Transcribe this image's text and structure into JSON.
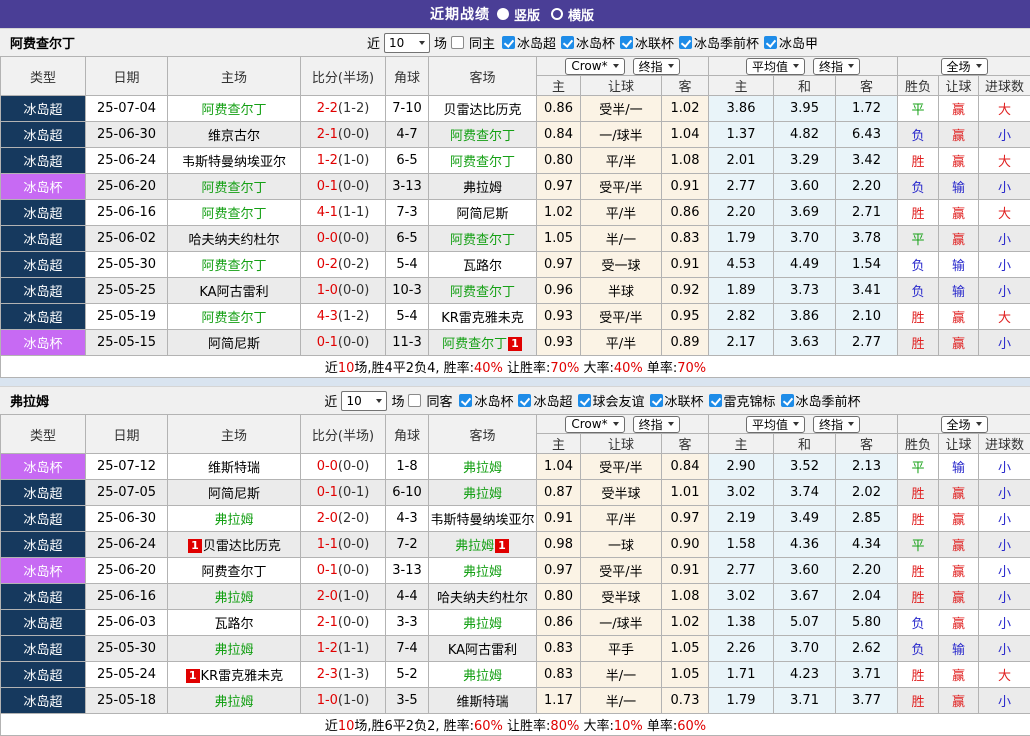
{
  "titlebar": {
    "title": "近期战绩",
    "radios": [
      {
        "id": "vertical",
        "label": "竖版",
        "checked": true
      },
      {
        "id": "horizontal",
        "label": "横版",
        "checked": false
      }
    ]
  },
  "colors": {
    "titlebar_bg": "#4a3e96",
    "league_super_bg": "#16395e",
    "league_cup_bg": "#c76af3",
    "focal_team": "#15a015",
    "score_red": "#e00000",
    "win_red": "#e02020",
    "lose_blue": "#2929cc",
    "draw_green": "#15a015",
    "crow_bg": "#fbf3e5",
    "avg_bg": "#e9f4f9",
    "stripe_bg": "#ebebeb",
    "checkbox_blue": "#1e8ce8",
    "separator_bg": "#d9e4f0"
  },
  "filter_labels": {
    "near": "近",
    "games": "场"
  },
  "badge_text": "1",
  "table_header": {
    "type": "类型",
    "date": "日期",
    "home": "主场",
    "score": "比分(半场)",
    "corner": "角球",
    "away": "客场",
    "group1": [
      "Crow*",
      "终指"
    ],
    "group2": [
      "平均值",
      "终指"
    ],
    "group3": [
      "全场"
    ],
    "sub": [
      "主",
      "让球",
      "客",
      "主",
      "和",
      "客",
      "胜负",
      "让球",
      "进球数"
    ]
  },
  "sections": [
    {
      "team": "阿费查尔丁",
      "filter": {
        "count": "10",
        "same": {
          "id": "same-home",
          "label": "同主",
          "checked": false
        },
        "leagues": [
          "冰岛超",
          "冰岛杯",
          "冰联杯",
          "冰岛季前杯",
          "冰岛甲"
        ]
      },
      "rows": [
        {
          "lg": "super",
          "type": "冰岛超",
          "date": "25-07-04",
          "home": "阿费查尔丁",
          "home_focal": true,
          "home_badge": "",
          "score": "2-2",
          "half": "(1-2)",
          "corner": "7-10",
          "away": "贝雷达比历克",
          "away_focal": false,
          "away_badge": "",
          "crow": [
            "0.86",
            "受半/一",
            "1.02"
          ],
          "avg": [
            "3.86",
            "3.95",
            "1.72"
          ],
          "res": [
            [
              "平",
              "draw"
            ],
            [
              "赢",
              "win"
            ],
            [
              "大",
              "win"
            ]
          ]
        },
        {
          "lg": "super",
          "type": "冰岛超",
          "date": "25-06-30",
          "home": "维京古尔",
          "home_focal": false,
          "home_badge": "",
          "score": "2-1",
          "half": "(0-0)",
          "corner": "4-7",
          "away": "阿费查尔丁",
          "away_focal": true,
          "away_badge": "",
          "crow": [
            "0.84",
            "一/球半",
            "1.04"
          ],
          "avg": [
            "1.37",
            "4.82",
            "6.43"
          ],
          "res": [
            [
              "负",
              "lose"
            ],
            [
              "赢",
              "win"
            ],
            [
              "小",
              "lose"
            ]
          ]
        },
        {
          "lg": "super",
          "type": "冰岛超",
          "date": "25-06-24",
          "home": "韦斯特曼纳埃亚尔",
          "home_focal": false,
          "home_badge": "",
          "score": "1-2",
          "half": "(1-0)",
          "corner": "6-5",
          "away": "阿费查尔丁",
          "away_focal": true,
          "away_badge": "",
          "crow": [
            "0.80",
            "平/半",
            "1.08"
          ],
          "avg": [
            "2.01",
            "3.29",
            "3.42"
          ],
          "res": [
            [
              "胜",
              "win"
            ],
            [
              "赢",
              "win"
            ],
            [
              "大",
              "win"
            ]
          ]
        },
        {
          "lg": "cup",
          "type": "冰岛杯",
          "date": "25-06-20",
          "home": "阿费查尔丁",
          "home_focal": true,
          "home_badge": "",
          "score": "0-1",
          "half": "(0-0)",
          "corner": "3-13",
          "away": "弗拉姆",
          "away_focal": false,
          "away_badge": "",
          "crow": [
            "0.97",
            "受平/半",
            "0.91"
          ],
          "avg": [
            "2.77",
            "3.60",
            "2.20"
          ],
          "res": [
            [
              "负",
              "lose"
            ],
            [
              "输",
              "lose"
            ],
            [
              "小",
              "lose"
            ]
          ]
        },
        {
          "lg": "super",
          "type": "冰岛超",
          "date": "25-06-16",
          "home": "阿费查尔丁",
          "home_focal": true,
          "home_badge": "",
          "score": "4-1",
          "half": "(1-1)",
          "corner": "7-3",
          "away": "阿简尼斯",
          "away_focal": false,
          "away_badge": "",
          "crow": [
            "1.02",
            "平/半",
            "0.86"
          ],
          "avg": [
            "2.20",
            "3.69",
            "2.71"
          ],
          "res": [
            [
              "胜",
              "win"
            ],
            [
              "赢",
              "win"
            ],
            [
              "大",
              "win"
            ]
          ]
        },
        {
          "lg": "super",
          "type": "冰岛超",
          "date": "25-06-02",
          "home": "哈夫纳夫约杜尔",
          "home_focal": false,
          "home_badge": "",
          "score": "0-0",
          "half": "(0-0)",
          "corner": "6-5",
          "away": "阿费查尔丁",
          "away_focal": true,
          "away_badge": "",
          "crow": [
            "1.05",
            "半/一",
            "0.83"
          ],
          "avg": [
            "1.79",
            "3.70",
            "3.78"
          ],
          "res": [
            [
              "平",
              "draw"
            ],
            [
              "赢",
              "win"
            ],
            [
              "小",
              "lose"
            ]
          ]
        },
        {
          "lg": "super",
          "type": "冰岛超",
          "date": "25-05-30",
          "home": "阿费查尔丁",
          "home_focal": true,
          "home_badge": "",
          "score": "0-2",
          "half": "(0-2)",
          "corner": "5-4",
          "away": "瓦路尔",
          "away_focal": false,
          "away_badge": "",
          "crow": [
            "0.97",
            "受一球",
            "0.91"
          ],
          "avg": [
            "4.53",
            "4.49",
            "1.54"
          ],
          "res": [
            [
              "负",
              "lose"
            ],
            [
              "输",
              "lose"
            ],
            [
              "小",
              "lose"
            ]
          ]
        },
        {
          "lg": "super",
          "type": "冰岛超",
          "date": "25-05-25",
          "home": "KA阿古雷利",
          "home_focal": false,
          "home_badge": "",
          "score": "1-0",
          "half": "(0-0)",
          "corner": "10-3",
          "away": "阿费查尔丁",
          "away_focal": true,
          "away_badge": "",
          "crow": [
            "0.96",
            "半球",
            "0.92"
          ],
          "avg": [
            "1.89",
            "3.73",
            "3.41"
          ],
          "res": [
            [
              "负",
              "lose"
            ],
            [
              "输",
              "lose"
            ],
            [
              "小",
              "lose"
            ]
          ]
        },
        {
          "lg": "super",
          "type": "冰岛超",
          "date": "25-05-19",
          "home": "阿费查尔丁",
          "home_focal": true,
          "home_badge": "",
          "score": "4-3",
          "half": "(1-2)",
          "corner": "5-4",
          "away": "KR雷克雅未克",
          "away_focal": false,
          "away_badge": "",
          "crow": [
            "0.93",
            "受平/半",
            "0.95"
          ],
          "avg": [
            "2.82",
            "3.86",
            "2.10"
          ],
          "res": [
            [
              "胜",
              "win"
            ],
            [
              "赢",
              "win"
            ],
            [
              "大",
              "win"
            ]
          ]
        },
        {
          "lg": "cup",
          "type": "冰岛杯",
          "date": "25-05-15",
          "home": "阿简尼斯",
          "home_focal": false,
          "home_badge": "",
          "score": "0-1",
          "half": "(0-0)",
          "corner": "11-3",
          "away": "阿费查尔丁",
          "away_focal": true,
          "away_badge": "after",
          "crow": [
            "0.93",
            "平/半",
            "0.89"
          ],
          "avg": [
            "2.17",
            "3.63",
            "2.77"
          ],
          "res": [
            [
              "胜",
              "win"
            ],
            [
              "赢",
              "win"
            ],
            [
              "小",
              "lose"
            ]
          ]
        }
      ],
      "summary": [
        {
          "text": "近",
          "red": false
        },
        {
          "text": "10",
          "red": true
        },
        {
          "text": "场,胜4平2负4, 胜率:",
          "red": false
        },
        {
          "text": "40%",
          "red": true
        },
        {
          "text": " 让胜率:",
          "red": false
        },
        {
          "text": "70%",
          "red": true
        },
        {
          "text": " 大率:",
          "red": false
        },
        {
          "text": "40%",
          "red": true
        },
        {
          "text": " 单率:",
          "red": false
        },
        {
          "text": "70%",
          "red": true
        }
      ]
    },
    {
      "team": "弗拉姆",
      "filter": {
        "count": "10",
        "same": {
          "id": "same-away",
          "label": "同客",
          "checked": false
        },
        "leagues": [
          "冰岛杯",
          "冰岛超",
          "球会友谊",
          "冰联杯",
          "雷克锦标",
          "冰岛季前杯"
        ]
      },
      "rows": [
        {
          "lg": "cup",
          "type": "冰岛杯",
          "date": "25-07-12",
          "home": "维斯特瑞",
          "home_focal": false,
          "home_badge": "",
          "score": "0-0",
          "half": "(0-0)",
          "corner": "1-8",
          "away": "弗拉姆",
          "away_focal": true,
          "away_badge": "",
          "crow": [
            "1.04",
            "受平/半",
            "0.84"
          ],
          "avg": [
            "2.90",
            "3.52",
            "2.13"
          ],
          "res": [
            [
              "平",
              "draw"
            ],
            [
              "输",
              "lose"
            ],
            [
              "小",
              "lose"
            ]
          ]
        },
        {
          "lg": "super",
          "type": "冰岛超",
          "date": "25-07-05",
          "home": "阿简尼斯",
          "home_focal": false,
          "home_badge": "",
          "score": "0-1",
          "half": "(0-1)",
          "corner": "6-10",
          "away": "弗拉姆",
          "away_focal": true,
          "away_badge": "",
          "crow": [
            "0.87",
            "受半球",
            "1.01"
          ],
          "avg": [
            "3.02",
            "3.74",
            "2.02"
          ],
          "res": [
            [
              "胜",
              "win"
            ],
            [
              "赢",
              "win"
            ],
            [
              "小",
              "lose"
            ]
          ]
        },
        {
          "lg": "super",
          "type": "冰岛超",
          "date": "25-06-30",
          "home": "弗拉姆",
          "home_focal": true,
          "home_badge": "",
          "score": "2-0",
          "half": "(2-0)",
          "corner": "4-3",
          "away": "韦斯特曼纳埃亚尔",
          "away_focal": false,
          "away_badge": "",
          "crow": [
            "0.91",
            "平/半",
            "0.97"
          ],
          "avg": [
            "2.19",
            "3.49",
            "2.85"
          ],
          "res": [
            [
              "胜",
              "win"
            ],
            [
              "赢",
              "win"
            ],
            [
              "小",
              "lose"
            ]
          ]
        },
        {
          "lg": "super",
          "type": "冰岛超",
          "date": "25-06-24",
          "home": "贝雷达比历克",
          "home_focal": false,
          "home_badge": "before",
          "score": "1-1",
          "half": "(0-0)",
          "corner": "7-2",
          "away": "弗拉姆",
          "away_focal": true,
          "away_badge": "after",
          "crow": [
            "0.98",
            "一球",
            "0.90"
          ],
          "avg": [
            "1.58",
            "4.36",
            "4.34"
          ],
          "res": [
            [
              "平",
              "draw"
            ],
            [
              "赢",
              "win"
            ],
            [
              "小",
              "lose"
            ]
          ]
        },
        {
          "lg": "cup",
          "type": "冰岛杯",
          "date": "25-06-20",
          "home": "阿费查尔丁",
          "home_focal": false,
          "home_badge": "",
          "score": "0-1",
          "half": "(0-0)",
          "corner": "3-13",
          "away": "弗拉姆",
          "away_focal": true,
          "away_badge": "",
          "crow": [
            "0.97",
            "受平/半",
            "0.91"
          ],
          "avg": [
            "2.77",
            "3.60",
            "2.20"
          ],
          "res": [
            [
              "胜",
              "win"
            ],
            [
              "赢",
              "win"
            ],
            [
              "小",
              "lose"
            ]
          ]
        },
        {
          "lg": "super",
          "type": "冰岛超",
          "date": "25-06-16",
          "home": "弗拉姆",
          "home_focal": true,
          "home_badge": "",
          "score": "2-0",
          "half": "(1-0)",
          "corner": "4-4",
          "away": "哈夫纳夫约杜尔",
          "away_focal": false,
          "away_badge": "",
          "crow": [
            "0.80",
            "受半球",
            "1.08"
          ],
          "avg": [
            "3.02",
            "3.67",
            "2.04"
          ],
          "res": [
            [
              "胜",
              "win"
            ],
            [
              "赢",
              "win"
            ],
            [
              "小",
              "lose"
            ]
          ]
        },
        {
          "lg": "super",
          "type": "冰岛超",
          "date": "25-06-03",
          "home": "瓦路尔",
          "home_focal": false,
          "home_badge": "",
          "score": "2-1",
          "half": "(0-0)",
          "corner": "3-3",
          "away": "弗拉姆",
          "away_focal": true,
          "away_badge": "",
          "crow": [
            "0.86",
            "一/球半",
            "1.02"
          ],
          "avg": [
            "1.38",
            "5.07",
            "5.80"
          ],
          "res": [
            [
              "负",
              "lose"
            ],
            [
              "赢",
              "win"
            ],
            [
              "小",
              "lose"
            ]
          ]
        },
        {
          "lg": "super",
          "type": "冰岛超",
          "date": "25-05-30",
          "home": "弗拉姆",
          "home_focal": true,
          "home_badge": "",
          "score": "1-2",
          "half": "(1-1)",
          "corner": "7-4",
          "away": "KA阿古雷利",
          "away_focal": false,
          "away_badge": "",
          "crow": [
            "0.83",
            "平手",
            "1.05"
          ],
          "avg": [
            "2.26",
            "3.70",
            "2.62"
          ],
          "res": [
            [
              "负",
              "lose"
            ],
            [
              "输",
              "lose"
            ],
            [
              "小",
              "lose"
            ]
          ]
        },
        {
          "lg": "super",
          "type": "冰岛超",
          "date": "25-05-24",
          "home": "KR雷克雅未克",
          "home_focal": false,
          "home_badge": "before",
          "score": "2-3",
          "half": "(1-3)",
          "corner": "5-2",
          "away": "弗拉姆",
          "away_focal": true,
          "away_badge": "",
          "crow": [
            "0.83",
            "半/一",
            "1.05"
          ],
          "avg": [
            "1.71",
            "4.23",
            "3.71"
          ],
          "res": [
            [
              "胜",
              "win"
            ],
            [
              "赢",
              "win"
            ],
            [
              "大",
              "win"
            ]
          ]
        },
        {
          "lg": "super",
          "type": "冰岛超",
          "date": "25-05-18",
          "home": "弗拉姆",
          "home_focal": true,
          "home_badge": "",
          "score": "1-0",
          "half": "(1-0)",
          "corner": "3-5",
          "away": "维斯特瑞",
          "away_focal": false,
          "away_badge": "",
          "crow": [
            "1.17",
            "半/一",
            "0.73"
          ],
          "avg": [
            "1.79",
            "3.71",
            "3.77"
          ],
          "res": [
            [
              "胜",
              "win"
            ],
            [
              "赢",
              "win"
            ],
            [
              "小",
              "lose"
            ]
          ]
        }
      ],
      "summary": [
        {
          "text": "近",
          "red": false
        },
        {
          "text": "10",
          "red": true
        },
        {
          "text": "场,胜6平2负2, 胜率:",
          "red": false
        },
        {
          "text": "60%",
          "red": true
        },
        {
          "text": " 让胜率:",
          "red": false
        },
        {
          "text": "80%",
          "red": true
        },
        {
          "text": " 大率:",
          "red": false
        },
        {
          "text": "10%",
          "red": true
        },
        {
          "text": " 单率:",
          "red": false
        },
        {
          "text": "60%",
          "red": true
        }
      ]
    }
  ]
}
